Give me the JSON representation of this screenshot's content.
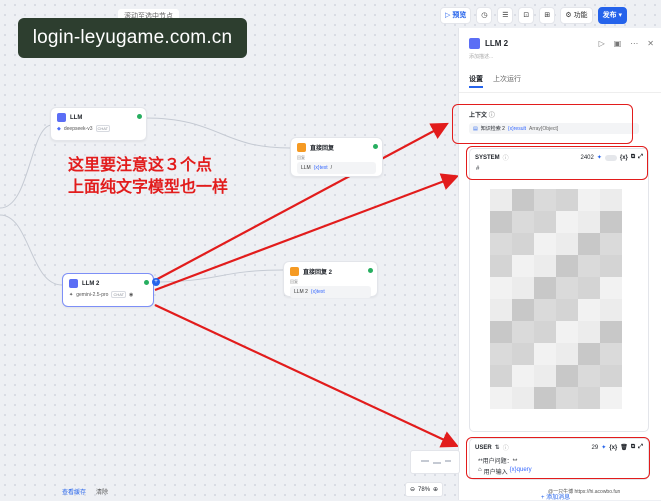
{
  "canvas": {
    "hint": "滚动至选中节点",
    "watermark": "login-leyugame.com.cn"
  },
  "toolbar": {
    "preview": "预览",
    "features": "功能",
    "publish": "发布"
  },
  "nodes": {
    "llm1": {
      "title": "LLM",
      "model": "deepseek-v3",
      "tag": "CHAT"
    },
    "reply1": {
      "title": "直接回复",
      "label": "回复",
      "ref_node": "LLM",
      "ref_var": "{x}text",
      "ref_suffix": "/"
    },
    "llm2": {
      "title": "LLM 2",
      "model": "gemini-2.5-pro",
      "tag": "CHAT"
    },
    "reply2": {
      "title": "直接回复 2",
      "label": "回复",
      "ref_node": "LLM 2",
      "ref_var": "{x}text"
    }
  },
  "annotation": {
    "line1": "这里要注意这３个点",
    "line2": "上面纯文字模型也一样"
  },
  "panel": {
    "title": "LLM 2",
    "description_placeholder": "添加描述...",
    "tabs": [
      "设置",
      "上次运行"
    ],
    "context_label": "上下文",
    "context_value_node": "知识检索 2",
    "context_value_var": "{x}result",
    "context_value_type": "Array[Object]",
    "system_label": "SYSTEM",
    "system_count": "2402",
    "system_first_line": "# ",
    "user_label": "USER",
    "user_count": "29",
    "user_text": "**用户问题：**",
    "user_var_node": "用户输入",
    "user_var": "{x}query",
    "add_message": "+ 添加消息"
  },
  "footer": {
    "view_cache": "查看缓存",
    "clear": "清除",
    "zoom": "78%",
    "credit": "@一只牛博 https://hi.acowbo.fun"
  },
  "colors": {
    "accent": "#2563eb",
    "annotation": "#e21c1c",
    "ok": "#27ae60"
  }
}
